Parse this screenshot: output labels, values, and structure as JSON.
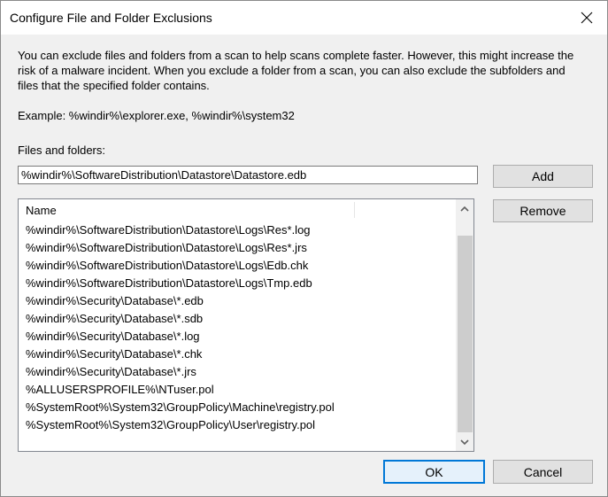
{
  "window": {
    "title": "Configure File and Folder Exclusions"
  },
  "description": "You can exclude files and folders from a scan to help scans complete faster. However, this might increase the risk of a malware incident. When you exclude a folder from a scan, you can also exclude the subfolders and files that the specified folder contains.",
  "example": "Example: %windir%\\explorer.exe, %windir%\\system32",
  "files_label": "Files and folders:",
  "path_input": {
    "value": "%windir%\\SoftwareDistribution\\Datastore\\Datastore.edb"
  },
  "buttons": {
    "add": "Add",
    "remove": "Remove",
    "ok": "OK",
    "cancel": "Cancel"
  },
  "list": {
    "column_header": "Name",
    "rows": [
      "%windir%\\SoftwareDistribution\\Datastore\\Logs\\Res*.log",
      "%windir%\\SoftwareDistribution\\Datastore\\Logs\\Res*.jrs",
      "%windir%\\SoftwareDistribution\\Datastore\\Logs\\Edb.chk",
      "%windir%\\SoftwareDistribution\\Datastore\\Logs\\Tmp.edb",
      "%windir%\\Security\\Database\\*.edb",
      "%windir%\\Security\\Database\\*.sdb",
      "%windir%\\Security\\Database\\*.log",
      "%windir%\\Security\\Database\\*.chk",
      "%windir%\\Security\\Database\\*.jrs",
      "%ALLUSERSPROFILE%\\NTuser.pol",
      "%SystemRoot%\\System32\\GroupPolicy\\Machine\\registry.pol",
      "%SystemRoot%\\System32\\GroupPolicy\\User\\registry.pol"
    ]
  },
  "icons": {
    "close": "close-icon",
    "scroll_up": "chevron-up-icon",
    "scroll_down": "chevron-down-icon"
  },
  "colors": {
    "accent": "#0078d7",
    "dialog_bg": "#f0f0f0",
    "button_bg": "#e1e1e1"
  }
}
